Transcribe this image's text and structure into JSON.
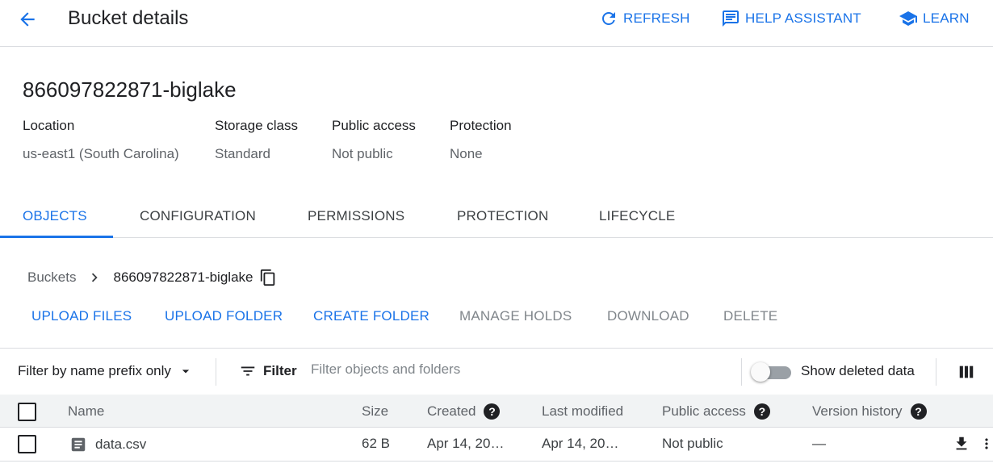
{
  "header": {
    "title": "Bucket details",
    "refresh_label": "REFRESH",
    "help_assistant_label": "HELP ASSISTANT",
    "learn_label": "LEARN"
  },
  "bucket": {
    "name": "866097822871-biglake",
    "meta": [
      {
        "label": "Location",
        "value": "us-east1 (South Carolina)"
      },
      {
        "label": "Storage class",
        "value": "Standard"
      },
      {
        "label": "Public access",
        "value": "Not public"
      },
      {
        "label": "Protection",
        "value": "None"
      }
    ]
  },
  "tabs": [
    {
      "label": "OBJECTS",
      "active": true
    },
    {
      "label": "CONFIGURATION",
      "active": false
    },
    {
      "label": "PERMISSIONS",
      "active": false
    },
    {
      "label": "PROTECTION",
      "active": false
    },
    {
      "label": "LIFECYCLE",
      "active": false
    }
  ],
  "breadcrumb": {
    "root": "Buckets",
    "current": "866097822871-biglake"
  },
  "actions": [
    {
      "label": "UPLOAD FILES",
      "enabled": true
    },
    {
      "label": "UPLOAD FOLDER",
      "enabled": true
    },
    {
      "label": "CREATE FOLDER",
      "enabled": true
    },
    {
      "label": "MANAGE HOLDS",
      "enabled": false
    },
    {
      "label": "DOWNLOAD",
      "enabled": false
    },
    {
      "label": "DELETE",
      "enabled": false
    }
  ],
  "filter": {
    "prefix_select": "Filter by name prefix only",
    "filter_label": "Filter",
    "placeholder": "Filter objects and folders",
    "show_deleted_label": "Show deleted data",
    "show_deleted_on": false
  },
  "table": {
    "headers": {
      "name": "Name",
      "size": "Size",
      "created": "Created",
      "last_modified": "Last modified",
      "public_access": "Public access",
      "version_history": "Version history"
    },
    "help_glyph": "?",
    "rows": [
      {
        "name": "data.csv",
        "size": "62 B",
        "created": "Apr 14, 20…",
        "last_modified": "Apr 14, 20…",
        "public_access": "Not public",
        "version_history": "—"
      }
    ]
  },
  "icons": {
    "back": "arrow-back-icon",
    "refresh": "refresh-icon",
    "help_assistant": "chat-feedback-icon",
    "learn": "school-icon",
    "breadcrumb_separator": "chevron-right-icon",
    "copy": "content-copy-icon",
    "dropdown": "arrow-drop-down-icon",
    "filter": "filter-list-icon",
    "columns": "view-column-icon",
    "file": "description-icon",
    "download": "download-icon",
    "more": "more-vert-icon"
  },
  "colors": {
    "accent": "#1a73e8",
    "disabled": "#80868b",
    "text": "#202124",
    "header_bg": "#f1f3f4",
    "divider": "#dadce0"
  }
}
